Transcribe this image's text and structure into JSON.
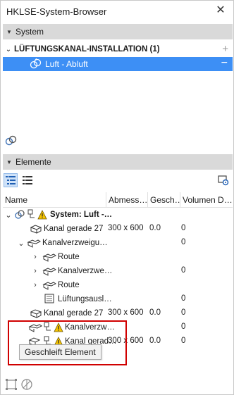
{
  "window": {
    "title": "HKLSE-System-Browser",
    "close_glyph": "✕"
  },
  "system_section": {
    "header": "System",
    "group_label": "LÜFTUNGSKANAL-INSTALLATION (1)",
    "add_glyph": "+",
    "selected_item": "Luft - Abluft",
    "remove_glyph": "−"
  },
  "elements_section": {
    "header": "Elemente",
    "columns": [
      "Name",
      "Abmess…",
      "Gesch…",
      "Volumen D…"
    ]
  },
  "tree": {
    "rows": [
      {
        "name": "System: Luft -…",
        "dim": "",
        "speed": "",
        "vol": ""
      },
      {
        "name": "Kanal gerade 27",
        "dim": "300 x 600",
        "speed": "0.0",
        "vol": "0"
      },
      {
        "name": "Kanalverzweigu…",
        "dim": "",
        "speed": "",
        "vol": "0"
      },
      {
        "name": "Route",
        "dim": "",
        "speed": "",
        "vol": ""
      },
      {
        "name": "Kanalverzwe…",
        "dim": "",
        "speed": "",
        "vol": "0"
      },
      {
        "name": "Route",
        "dim": "",
        "speed": "",
        "vol": ""
      },
      {
        "name": "Lüftungsausl…",
        "dim": "",
        "speed": "",
        "vol": "0"
      },
      {
        "name": "Kanal gerade 27",
        "dim": "300 x 600",
        "speed": "0.0",
        "vol": "0"
      },
      {
        "name": "Kanalverzw…",
        "dim": "",
        "speed": "",
        "vol": "0"
      },
      {
        "name": "Kanal gerad…",
        "dim": "300 x 600",
        "speed": "0.0",
        "vol": "0"
      }
    ]
  },
  "tooltip": "Geschleift Element",
  "colors": {
    "selection": "#3d8ff5",
    "header_bg": "#d9d9d9",
    "highlight_box": "#d00000",
    "warning": "#f5c400"
  },
  "icons": [
    "close-icon",
    "system-link-icon",
    "duct-icon",
    "warning-icon",
    "tree-view-icon",
    "list-view-icon",
    "settings-icon",
    "frame-icon",
    "target-icon"
  ]
}
